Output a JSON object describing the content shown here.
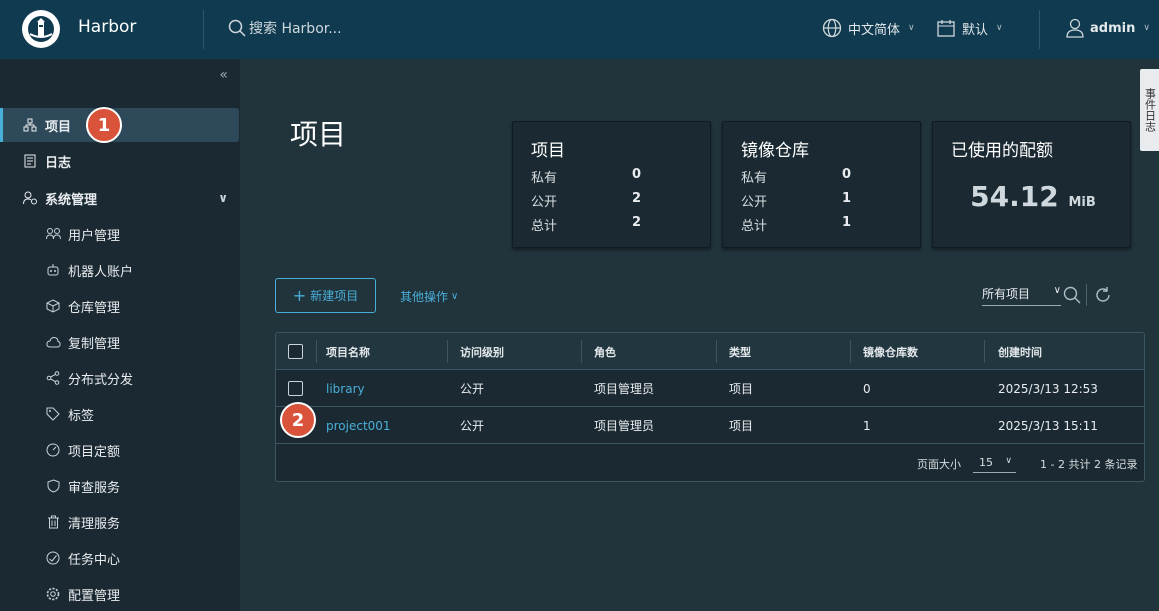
{
  "header": {
    "brand": "Harbor",
    "search_placeholder": "搜索 Harbor...",
    "language": "中文简体",
    "theme": "默认",
    "user": "admin"
  },
  "sidebar": {
    "items": [
      {
        "label": "项目",
        "icon": "project-icon"
      },
      {
        "label": "日志",
        "icon": "log-icon"
      },
      {
        "label": "系统管理",
        "icon": "admin-icon"
      }
    ],
    "sub_items": [
      {
        "label": "用户管理",
        "icon": "users-icon"
      },
      {
        "label": "机器人账户",
        "icon": "robot-icon"
      },
      {
        "label": "仓库管理",
        "icon": "box-icon"
      },
      {
        "label": "复制管理",
        "icon": "cloud-icon"
      },
      {
        "label": "分布式分发",
        "icon": "share-icon"
      },
      {
        "label": "标签",
        "icon": "tag-icon"
      },
      {
        "label": "项目定额",
        "icon": "gauge-icon"
      },
      {
        "label": "审查服务",
        "icon": "shield-icon"
      },
      {
        "label": "清理服务",
        "icon": "trash-icon"
      },
      {
        "label": "任务中心",
        "icon": "dashboard-icon"
      },
      {
        "label": "配置管理",
        "icon": "gear-icon"
      }
    ]
  },
  "annotations": {
    "one": "1",
    "two": "2"
  },
  "main": {
    "title": "项目",
    "event_log": "事件日志",
    "card_projects": {
      "title": "项目",
      "private_label": "私有",
      "private": "0",
      "public_label": "公开",
      "public": "2",
      "total_label": "总计",
      "total": "2"
    },
    "card_repos": {
      "title": "镜像仓库",
      "private_label": "私有",
      "private": "0",
      "public_label": "公开",
      "public": "1",
      "total_label": "总计",
      "total": "1"
    },
    "card_quota": {
      "title": "已使用的配额",
      "value": "54.12",
      "unit": "MiB"
    },
    "new_project": "新建项目",
    "more_actions": "其他操作",
    "filter": "所有项目",
    "columns": [
      "项目名称",
      "访问级别",
      "角色",
      "类型",
      "镜像仓库数",
      "创建时间"
    ],
    "rows": [
      {
        "name": "library",
        "access": "公开",
        "role": "项目管理员",
        "type": "项目",
        "repos": "0",
        "created": "2025/3/13 12:53"
      },
      {
        "name": "project001",
        "access": "公开",
        "role": "项目管理员",
        "type": "项目",
        "repos": "1",
        "created": "2025/3/13 15:11"
      }
    ],
    "page_size_label": "页面大小",
    "page_size": "15",
    "pagination": "1 - 2 共计 2 条记录"
  },
  "colors": {
    "accent": "#49afd9",
    "header": "#0f3a4f",
    "badge": "#d9533a"
  }
}
